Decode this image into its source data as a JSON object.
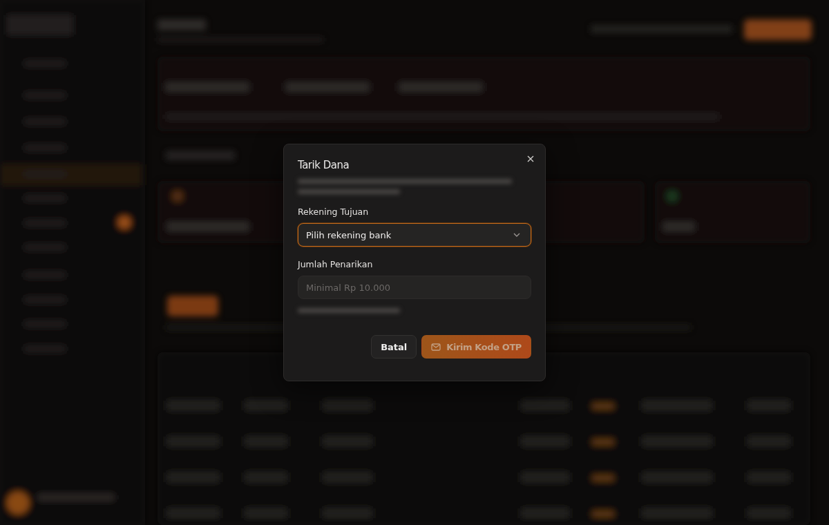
{
  "dialog": {
    "title": "Tarik Dana",
    "fields": [
      {
        "kind": "select",
        "label": "Rekening Tujuan",
        "value": "Pilih rekening bank",
        "focused": true
      },
      {
        "kind": "input",
        "label": "Jumlah Penarikan",
        "placeholder": "Minimal Rp 10.000",
        "focused": false
      }
    ],
    "buttons": [
      {
        "kind": "secondary",
        "label": "Batal",
        "disabled": false
      },
      {
        "kind": "primary",
        "label": "Kirim Kode OTP",
        "disabled": true
      }
    ]
  }
}
